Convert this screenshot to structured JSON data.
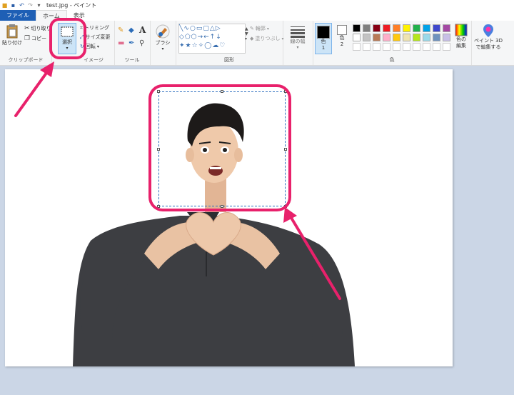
{
  "window": {
    "title": "test.jpg - ペイント"
  },
  "tabs": [
    "ファイル",
    "ホーム",
    "表示"
  ],
  "clipboard": {
    "paste": "貼り付け",
    "cut": "切り取り",
    "copy": "コピー",
    "group": "クリップボード"
  },
  "image": {
    "select": "選択",
    "crop": "トリミング",
    "resize": "サイズ変更",
    "rotate": "回転",
    "group": "イメージ"
  },
  "tools": {
    "group": "ツール",
    "brush": "ブラシ"
  },
  "shapes": {
    "group": "図形",
    "outline": "輪郭",
    "fill": "塗りつぶし"
  },
  "size": {
    "label": "線の幅"
  },
  "colors": {
    "color1": "色\n1",
    "color2": "色\n2",
    "edit": "色の\n編集",
    "group": "色",
    "swatches_row1": [
      "#000000",
      "#7f7f7f",
      "#880015",
      "#ed1c24",
      "#ff7f27",
      "#fff200",
      "#22b14c",
      "#00a2e8",
      "#3f48cc",
      "#a349a4"
    ],
    "swatches_row2": [
      "#ffffff",
      "#c3c3c3",
      "#b97a57",
      "#ffaec9",
      "#ffc90e",
      "#efe4b0",
      "#b5e61d",
      "#99d9ea",
      "#7092be",
      "#c8bfe7"
    ]
  },
  "paint3d": {
    "label": "ペイント 3D\nで編集する"
  },
  "accent": {
    "highlight": "#e8216b",
    "file_tab": "#1e5fb5"
  }
}
